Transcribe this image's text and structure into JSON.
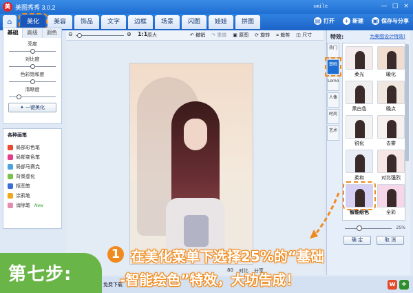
{
  "app": {
    "logo": "美",
    "title": "美图秀秀 3.0.2",
    "user": "smile",
    "window_controls": [
      "—",
      "□",
      "×"
    ]
  },
  "menu": {
    "home_icon": "home-icon",
    "tabs": [
      {
        "label": "美化",
        "active": true
      },
      {
        "label": "美容"
      },
      {
        "label": "饰品"
      },
      {
        "label": "文字"
      },
      {
        "label": "边框"
      },
      {
        "label": "场景"
      },
      {
        "label": "闪图"
      },
      {
        "label": "娃娃"
      },
      {
        "label": "拼图"
      }
    ],
    "right": {
      "open": "打开",
      "new": "新建",
      "save": "保存与分享"
    }
  },
  "toolbar": {
    "zoom_out": "⊖",
    "zoom_in": "⊕",
    "actual": "1:1",
    "actual_label": "原大",
    "undo": "撤销",
    "redo": "重做",
    "original": "原图",
    "rotate": "旋转",
    "crop": "裁剪",
    "size": "尺寸"
  },
  "left": {
    "tabs": [
      "基础",
      "高级",
      "调色"
    ],
    "sliders": [
      {
        "label": "亮度",
        "value": 0.5
      },
      {
        "label": "对比度",
        "value": 0.5
      },
      {
        "label": "色彩饱和度",
        "value": 0.5
      },
      {
        "label": "清晰度",
        "value": 0.2
      }
    ],
    "onekey": "一键美化",
    "brushes_title": "各种画笔",
    "brushes": [
      {
        "label": "局部彩色笔",
        "color": "#ea4a2f"
      },
      {
        "label": "局部变色笔",
        "color": "#e63b8e"
      },
      {
        "label": "局部马赛克",
        "color": "#4aa3e0"
      },
      {
        "label": "背景虚化",
        "color": "#7bc24a"
      },
      {
        "label": "抠图笔",
        "color": "#3a6fd8"
      },
      {
        "label": "涂鸦笔",
        "color": "#f0a81c"
      },
      {
        "label": "消除笔",
        "color": "#e88bb0",
        "badge": "New"
      }
    ]
  },
  "right": {
    "title": "特效:",
    "link": "为美图设计特效!",
    "side_tabs": [
      "热门",
      "基础",
      "Lomo",
      "人像",
      "时尚",
      "艺术"
    ],
    "selected_side_tab": "基础",
    "effects": [
      {
        "label": "柔光",
        "bg": "#f4ecec"
      },
      {
        "label": "暖化",
        "bg": "#f1dcd0"
      },
      {
        "label": "黑白色",
        "bg": "#f0f0f0"
      },
      {
        "label": "晚点",
        "bg": "#f0e8e0"
      },
      {
        "label": "锐化",
        "bg": "#f3f3f3"
      },
      {
        "label": "去雾",
        "bg": "#f6f1ee"
      },
      {
        "label": "柔和",
        "bg": "#e9edf5"
      },
      {
        "label": "对比强烈",
        "bg": "#f7e6e6"
      },
      {
        "label": "智能绘色",
        "bg": "#d5d0f4",
        "highlight": true
      },
      {
        "label": "全彩",
        "bg": "#f5d7e9"
      }
    ],
    "opacity_percent": 25,
    "opacity_text": "25%",
    "ok": "确 定",
    "cancel": "取 消"
  },
  "status": {
    "scale": "80",
    "compare": "对比",
    "share": "分享",
    "download": "免费下载"
  },
  "overlay": {
    "step": "第七步:",
    "num": "1",
    "line1": "在美化菜单下选择25%的“基础",
    "line2": "-智能绘色”特效，大功告成！"
  },
  "colors": {
    "accent": "#1f6fd3",
    "highlight": "#f08a1c",
    "step_green": "#6ab548"
  }
}
